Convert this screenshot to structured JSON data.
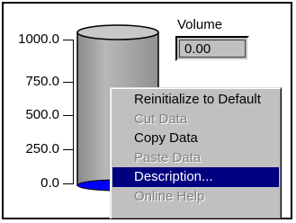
{
  "control": {
    "label": "Volume",
    "value": "0.00"
  },
  "tank": {
    "scale_ticks": [
      "1000.0",
      "750.0",
      "500.0",
      "250.0",
      "0.0"
    ],
    "range": [
      0,
      1000
    ],
    "fill_value": 0,
    "body_color": "#a0a0a0",
    "fill_color": "#0000ff"
  },
  "context_menu": {
    "items": [
      {
        "label": "Reinitialize to Default",
        "state": "enabled"
      },
      {
        "label": "Cut Data",
        "state": "disabled"
      },
      {
        "label": "Copy Data",
        "state": "enabled"
      },
      {
        "label": "Paste Data",
        "state": "disabled"
      },
      {
        "label": "Description...",
        "state": "selected"
      },
      {
        "label": "Online Help",
        "state": "disabled"
      }
    ],
    "highlight_color": "#000080"
  }
}
